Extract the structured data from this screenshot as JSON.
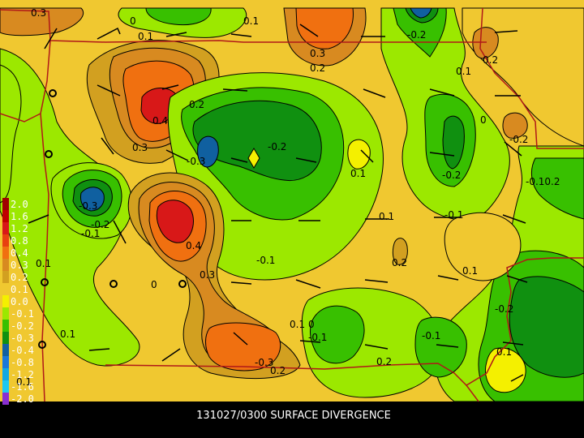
{
  "caption": "131027/0300 SURFACE DIVERGENCE",
  "legend": {
    "entries": [
      {
        "label": "2.0",
        "color": "#a00000"
      },
      {
        "label": "1.6",
        "color": "#c00000"
      },
      {
        "label": "1.2",
        "color": "#d81818"
      },
      {
        "label": "0.8",
        "color": "#e84010"
      },
      {
        "label": "0.4",
        "color": "#f07010"
      },
      {
        "label": "0.3",
        "color": "#d88a20"
      },
      {
        "label": "0.2",
        "color": "#d2a020"
      },
      {
        "label": "0.1",
        "color": "#f0c830"
      },
      {
        "label": "0.0",
        "color": "#f4f000"
      },
      {
        "label": "-0.1",
        "color": "#9ce800"
      },
      {
        "label": "-0.2",
        "color": "#38c000"
      },
      {
        "label": "-0.3",
        "color": "#109010"
      },
      {
        "label": "-0.4",
        "color": "#1060a0"
      },
      {
        "label": "-0.8",
        "color": "#1878d8"
      },
      {
        "label": "-1.2",
        "color": "#10a8e0"
      },
      {
        "label": "-1.6",
        "color": "#20c8f0"
      },
      {
        "label": "-2.0",
        "color": "#8a30d0"
      }
    ]
  },
  "contour_labels": [
    {
      "text": "0.3"
    },
    {
      "text": "0"
    },
    {
      "text": "0.1"
    },
    {
      "text": "0.1"
    },
    {
      "text": "-0.2"
    },
    {
      "text": "0.3"
    },
    {
      "text": "0.2"
    },
    {
      "text": "0.1"
    },
    {
      "text": "0.2"
    },
    {
      "text": "0.2"
    },
    {
      "text": "0.4"
    },
    {
      "text": "0.3"
    },
    {
      "text": "-0.3"
    },
    {
      "text": "-0.2"
    },
    {
      "text": "0"
    },
    {
      "text": "0.1"
    },
    {
      "text": "-0.2"
    },
    {
      "text": "-0.10.2"
    },
    {
      "text": "-0.2"
    },
    {
      "text": "-0.3"
    },
    {
      "text": "-0.2"
    },
    {
      "text": "-0.1"
    },
    {
      "text": "0.1"
    },
    {
      "text": "0.1"
    },
    {
      "text": "-0.1"
    },
    {
      "text": "0.4"
    },
    {
      "text": "-0.1"
    },
    {
      "text": "0.2"
    },
    {
      "text": "0.1"
    },
    {
      "text": "0"
    },
    {
      "text": "0.3"
    },
    {
      "text": "-0.2"
    },
    {
      "text": "0.1"
    },
    {
      "text": "0.1"
    },
    {
      "text": "0"
    },
    {
      "text": "-0.1"
    },
    {
      "text": "-0.1"
    },
    {
      "text": "-0.3"
    },
    {
      "text": "0.2"
    },
    {
      "text": "0.2"
    },
    {
      "text": "0.1"
    },
    {
      "text": "0.1"
    }
  ],
  "colors": {
    "border": "#b01818",
    "contour": "#000000",
    "background": "#000000",
    "text": "#ffffff"
  }
}
